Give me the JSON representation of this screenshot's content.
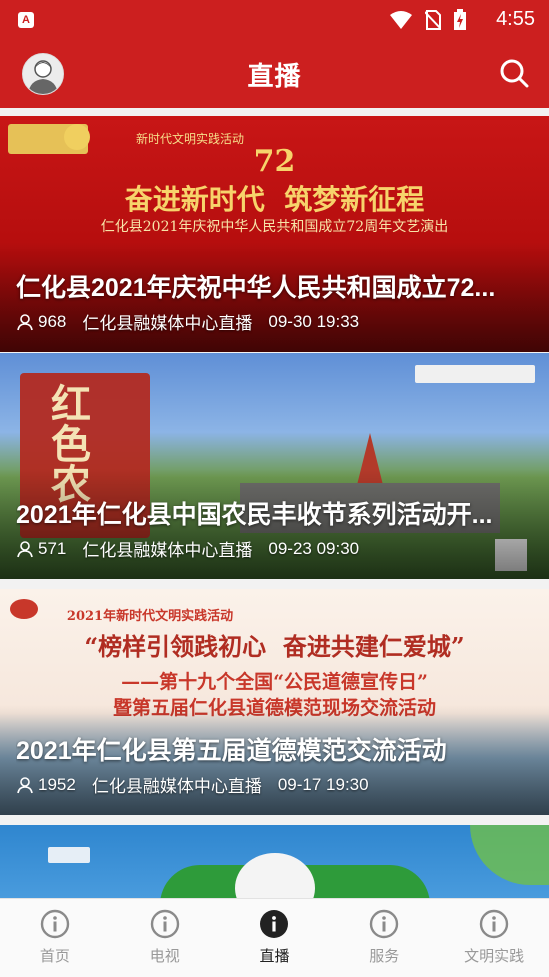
{
  "status_bar": {
    "time": "4:55",
    "app_badge": "A"
  },
  "header": {
    "title": "直播"
  },
  "cards": [
    {
      "title": "仁化县2021年庆祝中华人民共和国成立72...",
      "viewers": "968",
      "source": "仁化县融媒体中心直播",
      "time": "09-30 19:33",
      "banner_top": "新时代文明实践活动",
      "banner_num": "72",
      "banner_slogan": "奋进新时代  筑梦新征程",
      "banner_sub": "仁化县2021年庆祝中华人民共和国成立72周年文艺演出"
    },
    {
      "title": "2021年仁化县中国农民丰收节系列活动开...",
      "viewers": "571",
      "source": "仁化县融媒体中心直播",
      "time": "09-23 09:30",
      "banner_side": "红色农"
    },
    {
      "title": "2021年仁化县第五届道德模范交流活动",
      "viewers": "1952",
      "source": "仁化县融媒体中心直播",
      "time": "09-17 19:30",
      "banner_top": "2021年新时代文明实践活动",
      "banner_slogan": "“榜样引领践初心  奋进共建仁爱城”",
      "banner_line1": "——第十九个全国“公民道德宣传日”",
      "banner_line2": "暨第五届仁化县道德模范现场交流活动"
    }
  ],
  "tabs": [
    {
      "label": "首页",
      "active": false
    },
    {
      "label": "电视",
      "active": false
    },
    {
      "label": "直播",
      "active": true
    },
    {
      "label": "服务",
      "active": false
    },
    {
      "label": "文明实践",
      "active": false
    }
  ],
  "colors": {
    "brand_red": "#cc1f1f",
    "tab_inactive": "#999999",
    "tab_active": "#222222"
  }
}
